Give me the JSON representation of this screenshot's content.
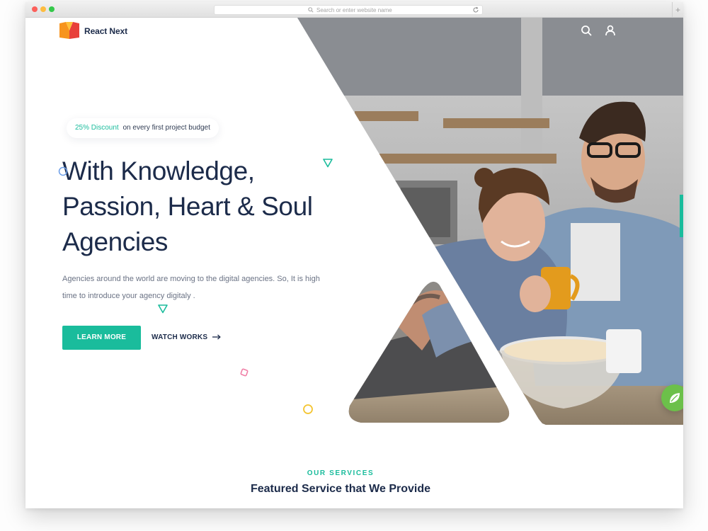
{
  "browser": {
    "url_placeholder": "Search or enter website name",
    "new_tab_label": "+"
  },
  "header": {
    "brand": "React Next",
    "icons": [
      "search-icon",
      "user-icon"
    ]
  },
  "hero": {
    "discount_accent": "25% Discount",
    "discount_text": "on every first project budget",
    "headline": [
      "With Knowledge,",
      "Passion, Heart & Soul",
      "Agencies"
    ],
    "subtext": [
      "Agencies around the world are moving to the digital agencies. So, It is high",
      "time to introduce your agency digitaly ."
    ],
    "learn_more_label": "LEARN MORE",
    "watch_works_label": "WATCH WORKS"
  },
  "services": {
    "eyebrow": "OUR SERVICES",
    "title": "Featured Service that We Provide"
  },
  "colors": {
    "accent": "#1abc9c",
    "heading": "#1c2b4a",
    "body_text": "#6b7385",
    "chat_widget": "#6cc04a"
  }
}
